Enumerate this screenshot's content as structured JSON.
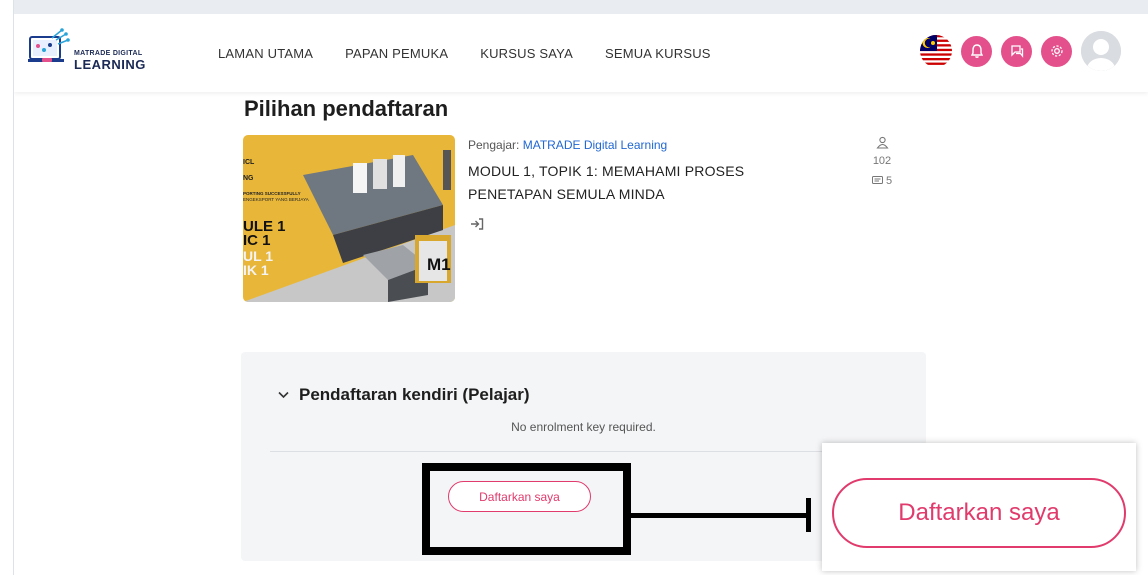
{
  "brand": {
    "logo_text_top": "MATRADE DIGITAL",
    "logo_text_bottom": "LEARNING"
  },
  "nav": {
    "items": [
      {
        "label": "LAMAN UTAMA"
      },
      {
        "label": "PAPAN PEMUKA"
      },
      {
        "label": "KURSUS SAYA"
      },
      {
        "label": "SEMUA KURSUS"
      }
    ],
    "right_icons": [
      "malaysia-flag-icon",
      "bell-icon",
      "chat-icon",
      "gear-icon",
      "avatar"
    ]
  },
  "page": {
    "title": "Pilihan pendaftaran"
  },
  "course": {
    "teacher_label": "Pengajar: ",
    "teacher_name": "MATRADE Digital Learning",
    "title": "MODUL 1, TOPIK 1: MEMAHAMI PROSES PENETAPAN SEMULA MINDA",
    "participants": "102",
    "forum_posts": "5",
    "image_text": {
      "line1": "ULE 1",
      "line2": "IC 1",
      "line3": "UL 1",
      "line4": "IK 1",
      "badge": "M1",
      "small1": "NG",
      "small2": "PORTING SUCCESSFULLY",
      "small3": "ENGEKSPORT YANG BERJAYA",
      "small4": "ICL"
    }
  },
  "enrolment": {
    "heading": "Pendaftaran kendiri (Pelajar)",
    "note": "No enrolment key required.",
    "button_label": "Daftarkan saya"
  },
  "annotation": {
    "zoom_button_label": "Daftarkan saya"
  },
  "colors": {
    "accent": "#e13a6c",
    "nav_icon_bg": "#e4508b",
    "link": "#2168d3",
    "panel_bg": "#f4f5f7"
  }
}
